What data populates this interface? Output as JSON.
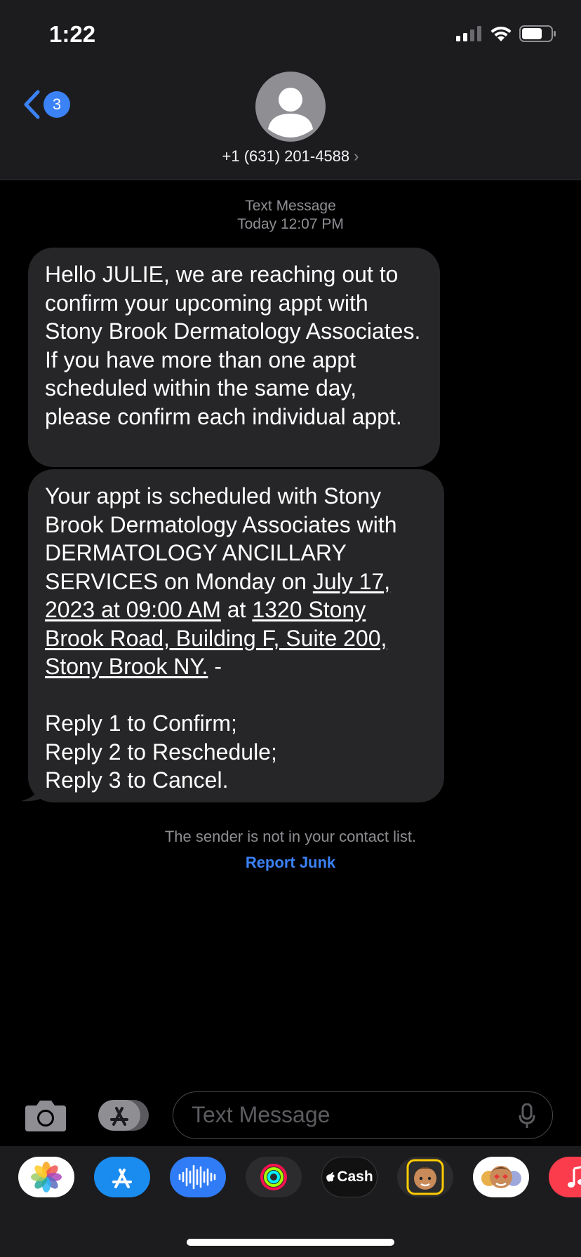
{
  "status_bar": {
    "time": "1:22"
  },
  "header": {
    "unread_count": "3",
    "contact": "+1 (631) 201-4588",
    "chevron": "›"
  },
  "thread": {
    "service": "Text Message",
    "timestamp": "Today 12:07 PM",
    "messages": [
      {
        "text": "Hello JULIE, we are reaching out to confirm your upcoming appt with Stony Brook Dermatology Associates. If you have more than one appt scheduled within the same day, please confirm each individual appt."
      },
      {
        "intro": "Your appt is scheduled with Stony Brook Dermatology Associates with DERMATOLOGY ANCILLARY SERVICES on Monday on ",
        "date_link": "July 17, 2023 at 09:00 AM",
        "at": " at ",
        "address_link": "1320 Stony Brook Road, Building F, Suite 200, Stony Brook NY.",
        "dash": " -",
        "reply1": "Reply 1 to Confirm;",
        "reply2": "Reply 2 to Reschedule;",
        "reply3": "Reply 3 to Cancel."
      }
    ],
    "notice": "The sender is not in your contact list.",
    "report_junk": "Report Junk"
  },
  "composer": {
    "placeholder": "Text Message"
  },
  "apps": [
    {
      "name": "photos-app",
      "color": "#ffffff"
    },
    {
      "name": "app-store-app",
      "color": "#1a8cf0"
    },
    {
      "name": "audio-message-app",
      "color": "#2f7cf6"
    },
    {
      "name": "activity-app",
      "color": "#2c2c2e"
    },
    {
      "name": "apple-cash-app",
      "color": "#111111",
      "label": "Cash"
    },
    {
      "name": "memoji-app",
      "color": "#2c2c2e"
    },
    {
      "name": "memoji-stickers-app",
      "color": "#ffffff"
    },
    {
      "name": "music-app",
      "color": "#fa3c4c"
    }
  ],
  "colors": {
    "accent": "#3b82f6",
    "bubble": "#262628",
    "header": "#1c1c1e"
  }
}
